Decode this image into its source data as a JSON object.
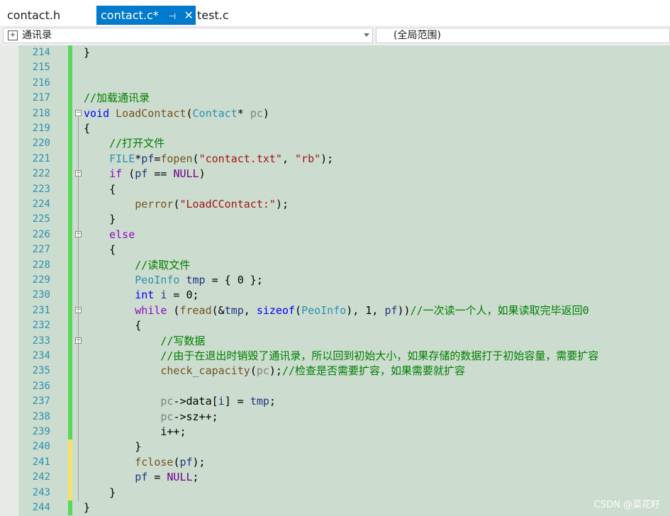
{
  "tabs": [
    {
      "label": "contact.h",
      "active": false
    },
    {
      "label": "contact.c*",
      "active": true
    },
    {
      "label": "test.c",
      "active": false
    }
  ],
  "navbar": {
    "scope_left": "通讯录",
    "scope_right": "(全局范围)"
  },
  "colors": {
    "accent_tab": "#007acc",
    "editor_bg": "#ccdccf",
    "line_number": "#2b91af",
    "change_saved": "#57d957",
    "change_unsaved": "#f5e06b"
  },
  "editor": {
    "lines": [
      {
        "n": "214",
        "text": "}"
      },
      {
        "n": "215",
        "text": ""
      },
      {
        "n": "216",
        "text": ""
      },
      {
        "n": "217",
        "text": "//加载通讯录"
      },
      {
        "n": "218",
        "text": "void LoadContact(Contact* pc)"
      },
      {
        "n": "219",
        "text": "{"
      },
      {
        "n": "220",
        "text": "    //打开文件"
      },
      {
        "n": "221",
        "text": "    FILE*pf=fopen(\"contact.txt\", \"rb\");"
      },
      {
        "n": "222",
        "text": "    if (pf == NULL)"
      },
      {
        "n": "223",
        "text": "    {"
      },
      {
        "n": "224",
        "text": "        perror(\"LoadCContact:\");"
      },
      {
        "n": "225",
        "text": "    }"
      },
      {
        "n": "226",
        "text": "    else"
      },
      {
        "n": "227",
        "text": "    {"
      },
      {
        "n": "228",
        "text": "        //读取文件"
      },
      {
        "n": "229",
        "text": "        PeoInfo tmp = { 0 };"
      },
      {
        "n": "230",
        "text": "        int i = 0;"
      },
      {
        "n": "231",
        "text": "        while (fread(&tmp, sizeof(PeoInfo), 1, pf))//一次读一个人，如果读取完毕返回0"
      },
      {
        "n": "232",
        "text": "        {"
      },
      {
        "n": "233",
        "text": "            //写数据"
      },
      {
        "n": "234",
        "text": "            //由于在退出时销毁了通讯录，所以回到初始大小，如果存储的数据打于初始容量，需要扩容"
      },
      {
        "n": "235",
        "text": "            check_capacity(pc);//检查是否需要扩容，如果需要就扩容"
      },
      {
        "n": "236",
        "text": ""
      },
      {
        "n": "237",
        "text": "            pc->data[i] = tmp;"
      },
      {
        "n": "238",
        "text": "            pc->sz++;"
      },
      {
        "n": "239",
        "text": "            i++;"
      },
      {
        "n": "240",
        "text": "        }"
      },
      {
        "n": "241",
        "text": "        fclose(pf);"
      },
      {
        "n": "242",
        "text": "        pf = NULL;"
      },
      {
        "n": "243",
        "text": "    }"
      },
      {
        "n": "244",
        "text": "}"
      }
    ]
  },
  "watermark": "CSDN @菜花籽"
}
